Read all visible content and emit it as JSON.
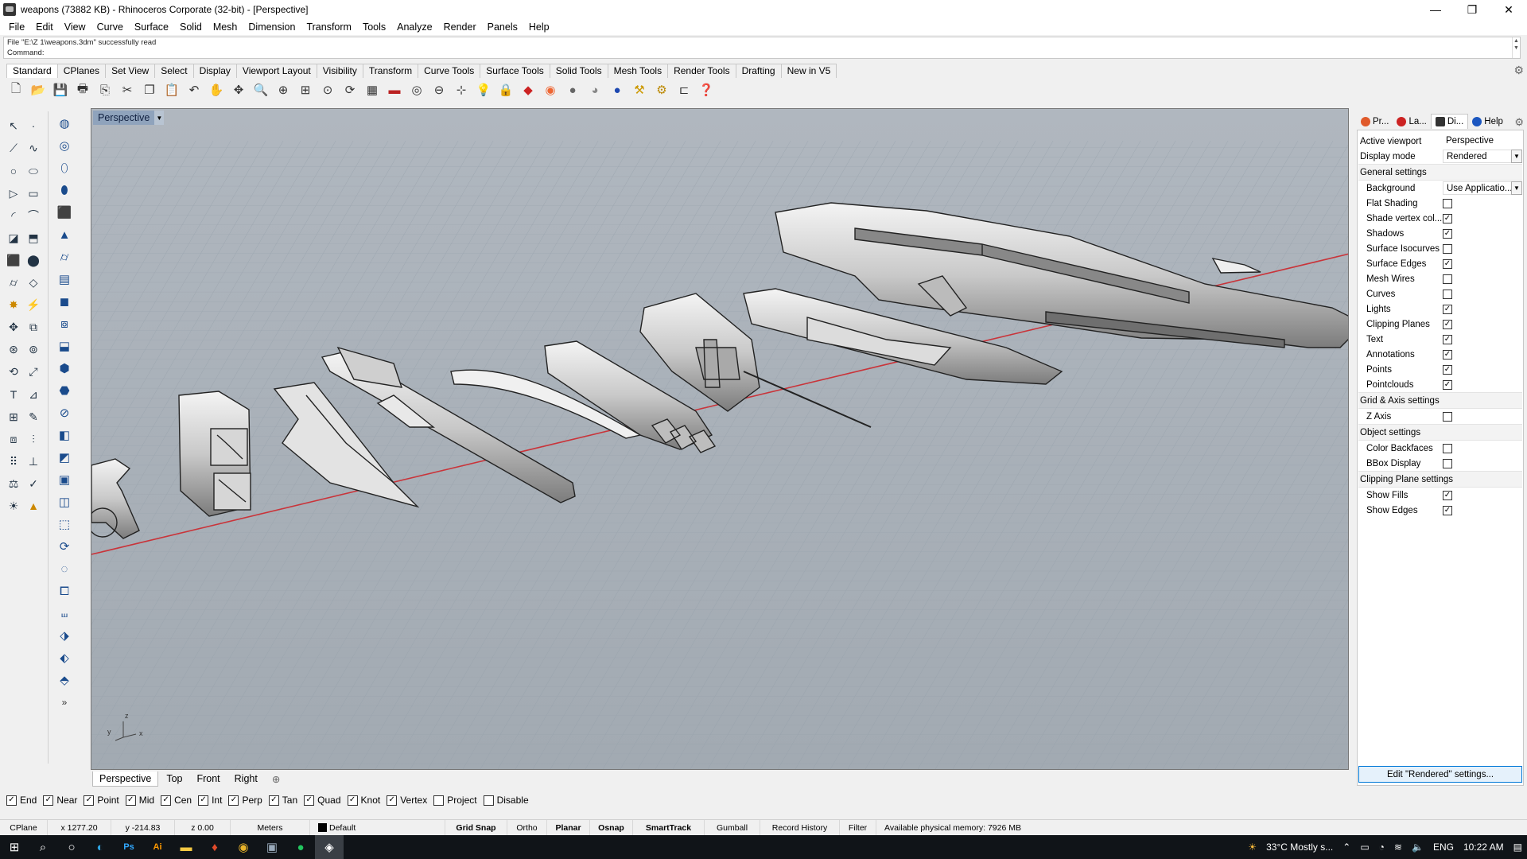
{
  "window": {
    "title": "weapons (73882 KB) - Rhinoceros Corporate (32-bit) - [Perspective]",
    "controls": [
      "—",
      "❐",
      "✕"
    ]
  },
  "menu": [
    "File",
    "Edit",
    "View",
    "Curve",
    "Surface",
    "Solid",
    "Mesh",
    "Dimension",
    "Transform",
    "Tools",
    "Analyze",
    "Render",
    "Panels",
    "Help"
  ],
  "command": {
    "history": "File \"E:\\Z 1\\weapons.3dm\" successfully read",
    "prompt": "Command:"
  },
  "toolbar_tabs": [
    "Standard",
    "CPlanes",
    "Set View",
    "Select",
    "Display",
    "Viewport Layout",
    "Visibility",
    "Transform",
    "Curve Tools",
    "Surface Tools",
    "Solid Tools",
    "Mesh Tools",
    "Render Tools",
    "Drafting",
    "New in V5"
  ],
  "viewport": {
    "name": "Perspective",
    "axis": {
      "z": "z",
      "y": "y",
      "x": "x"
    }
  },
  "view_tabs": [
    "Perspective",
    "Top",
    "Front",
    "Right"
  ],
  "panel": {
    "tabs": [
      "Pr...",
      "La...",
      "Di...",
      "Help"
    ],
    "active_viewport_label": "Active viewport",
    "active_viewport_value": "Perspective",
    "display_mode_label": "Display mode",
    "display_mode_value": "Rendered",
    "general_header": "General settings",
    "background_label": "Background",
    "background_value": "Use Applicatio...",
    "general_items": [
      {
        "label": "Flat Shading",
        "checked": false
      },
      {
        "label": "Shade vertex col...",
        "checked": true
      },
      {
        "label": "Shadows",
        "checked": true
      },
      {
        "label": "Surface Isocurves",
        "checked": false
      },
      {
        "label": "Surface Edges",
        "checked": true
      },
      {
        "label": "Mesh Wires",
        "checked": false
      },
      {
        "label": "Curves",
        "checked": false
      },
      {
        "label": "Lights",
        "checked": true
      },
      {
        "label": "Clipping Planes",
        "checked": true
      },
      {
        "label": "Text",
        "checked": true
      },
      {
        "label": "Annotations",
        "checked": true
      },
      {
        "label": "Points",
        "checked": true
      },
      {
        "label": "Pointclouds",
        "checked": true
      }
    ],
    "grid_header": "Grid & Axis settings",
    "grid_items": [
      {
        "label": "Z Axis",
        "checked": false
      }
    ],
    "object_header": "Object settings",
    "object_items": [
      {
        "label": "Color Backfaces",
        "checked": false
      },
      {
        "label": "BBox Display",
        "checked": false
      }
    ],
    "clipping_header": "Clipping Plane settings",
    "clipping_items": [
      {
        "label": "Show Fills",
        "checked": true
      },
      {
        "label": "Show Edges",
        "checked": true
      }
    ],
    "edit_button": "Edit \"Rendered\" settings..."
  },
  "osnaps": [
    {
      "label": "End",
      "checked": true
    },
    {
      "label": "Near",
      "checked": true
    },
    {
      "label": "Point",
      "checked": true
    },
    {
      "label": "Mid",
      "checked": true
    },
    {
      "label": "Cen",
      "checked": true
    },
    {
      "label": "Int",
      "checked": true
    },
    {
      "label": "Perp",
      "checked": true
    },
    {
      "label": "Tan",
      "checked": true
    },
    {
      "label": "Quad",
      "checked": true
    },
    {
      "label": "Knot",
      "checked": true
    },
    {
      "label": "Vertex",
      "checked": true
    },
    {
      "label": "Project",
      "checked": false
    },
    {
      "label": "Disable",
      "checked": false
    }
  ],
  "status": {
    "cplane": "CPlane",
    "x": "x 1277.20",
    "y": "y -214.83",
    "z": "z 0.00",
    "units": "Meters",
    "layer": "Default",
    "grid_snap": "Grid Snap",
    "ortho": "Ortho",
    "planar": "Planar",
    "osnap": "Osnap",
    "smarttrack": "SmartTrack",
    "gumball": "Gumball",
    "record_history": "Record History",
    "filter": "Filter",
    "memory": "Available physical memory: 7926 MB"
  },
  "taskbar": {
    "weather": "33°C  Mostly s...",
    "lang": "ENG",
    "time": "10:22 AM"
  }
}
